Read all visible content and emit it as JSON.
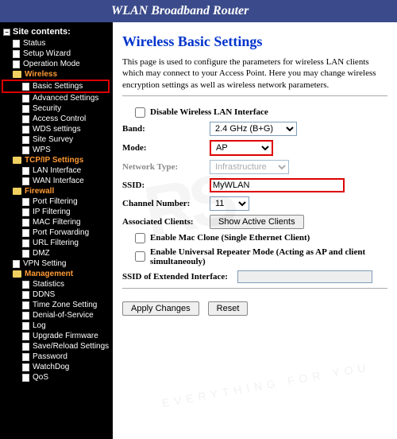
{
  "header": {
    "title": "WLAN Broadband Router"
  },
  "sidebar": {
    "title": "Site contents:",
    "items": [
      {
        "type": "page",
        "label": "Status"
      },
      {
        "type": "page",
        "label": "Setup Wizard"
      },
      {
        "type": "page",
        "label": "Operation Mode"
      },
      {
        "type": "folder",
        "label": "Wireless",
        "open": true,
        "children": [
          {
            "label": "Basic Settings",
            "hl": true
          },
          {
            "label": "Advanced Settings"
          },
          {
            "label": "Security"
          },
          {
            "label": "Access Control"
          },
          {
            "label": "WDS settings"
          },
          {
            "label": "Site Survey"
          },
          {
            "label": "WPS"
          }
        ]
      },
      {
        "type": "folder",
        "label": "TCP/IP Settings",
        "open": true,
        "children": [
          {
            "label": "LAN Interface"
          },
          {
            "label": "WAN Interface"
          }
        ]
      },
      {
        "type": "folder",
        "label": "Firewall",
        "open": true,
        "children": [
          {
            "label": "Port Filtering"
          },
          {
            "label": "IP Filtering"
          },
          {
            "label": "MAC Filtering"
          },
          {
            "label": "Port Forwarding"
          },
          {
            "label": "URL Filtering"
          },
          {
            "label": "DMZ"
          }
        ]
      },
      {
        "type": "page",
        "label": "VPN Setting"
      },
      {
        "type": "folder",
        "label": "Management",
        "open": true,
        "children": [
          {
            "label": "Statistics"
          },
          {
            "label": "DDNS"
          },
          {
            "label": "Time Zone Setting"
          },
          {
            "label": "Denial-of-Service"
          },
          {
            "label": "Log"
          },
          {
            "label": "Upgrade Firmware"
          },
          {
            "label": "Save/Reload Settings"
          },
          {
            "label": "Password"
          },
          {
            "label": "WatchDog"
          },
          {
            "label": "QoS"
          }
        ]
      }
    ]
  },
  "main": {
    "heading": "Wireless Basic Settings",
    "description": "This page is used to configure the parameters for wireless LAN clients which may connect to your Access Point. Here you may change wireless encryption settings as well as wireless network parameters.",
    "disable_label": "Disable Wireless LAN Interface",
    "band_label": "Band:",
    "band_value": "2.4 GHz (B+G)",
    "mode_label": "Mode:",
    "mode_value": "AP",
    "network_type_label": "Network Type:",
    "network_type_value": "Infrastructure",
    "ssid_label": "SSID:",
    "ssid_value": "MyWLAN",
    "channel_label": "Channel Number:",
    "channel_value": "11",
    "clients_label": "Associated Clients:",
    "clients_button": "Show Active Clients",
    "mac_clone_label": "Enable Mac Clone (Single Ethernet Client)",
    "repeater_label": "Enable Universal Repeater Mode (Acting as AP and client simultaneouly)",
    "ext_ssid_label": "SSID of Extended Interface:",
    "ext_ssid_value": "",
    "apply_button": "Apply Changes",
    "reset_button": "Reset"
  }
}
